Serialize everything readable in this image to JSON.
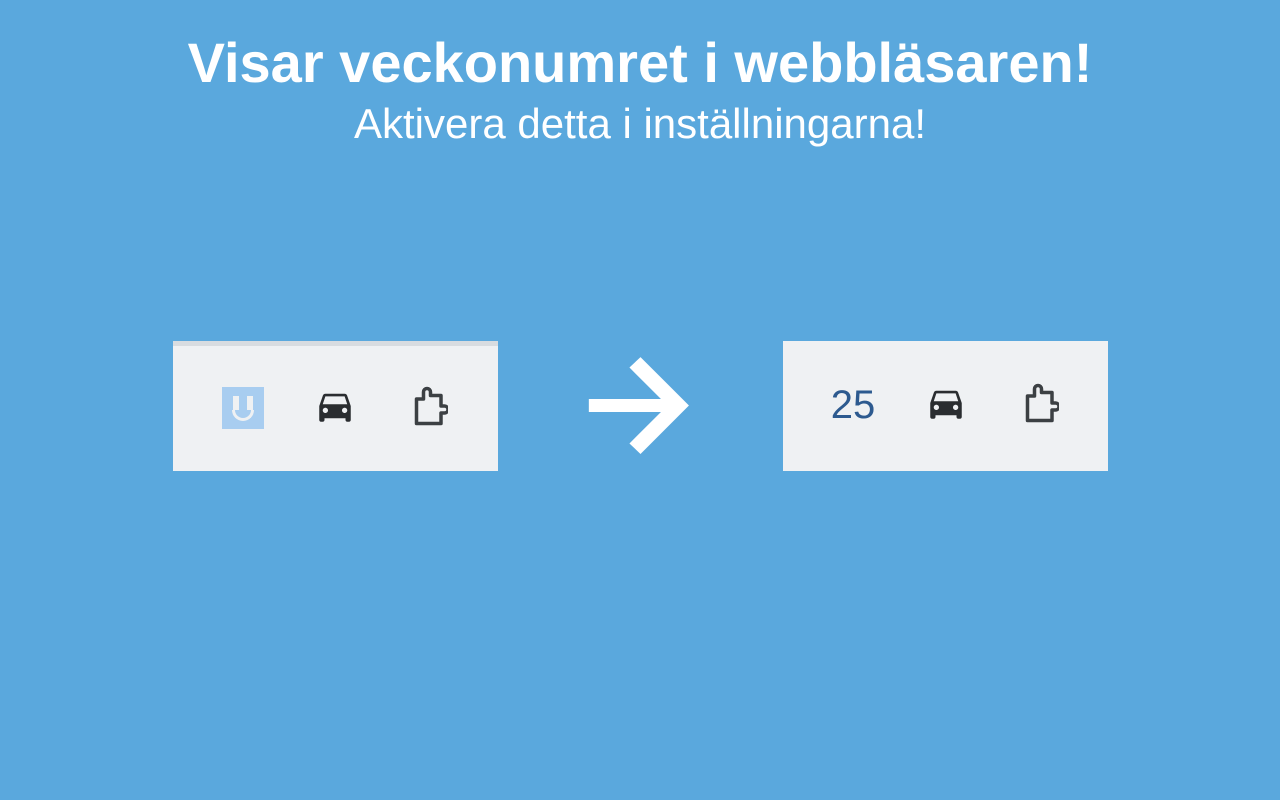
{
  "heading": "Visar veckonumret i webbläsaren!",
  "subheading": "Aktivera detta i inställningarna!",
  "weekNumber": "25"
}
